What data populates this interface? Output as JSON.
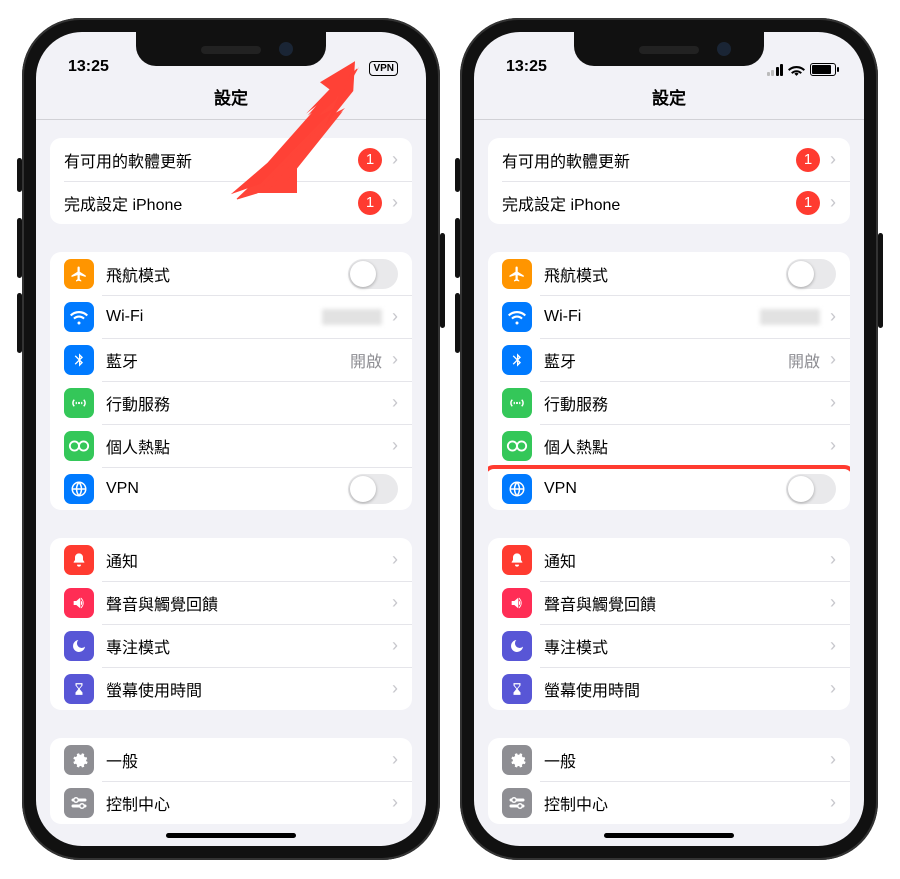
{
  "status": {
    "time": "13:25",
    "vpn_label": "VPN"
  },
  "nav": {
    "title": "設定"
  },
  "group_updates": {
    "software_update": "有可用的軟體更新",
    "software_badge": "1",
    "finish_setup": "完成設定 iPhone",
    "finish_badge": "1"
  },
  "group_net": {
    "airplane": "飛航模式",
    "wifi": "Wi-Fi",
    "bluetooth": "藍牙",
    "bluetooth_status": "開啟",
    "cellular": "行動服務",
    "hotspot": "個人熱點",
    "vpn": "VPN"
  },
  "group_notify": {
    "notifications": "通知",
    "sounds": "聲音與觸覺回饋",
    "focus": "專注模式",
    "screentime": "螢幕使用時間"
  },
  "group_general": {
    "general": "一般",
    "control": "控制中心"
  },
  "colors": {
    "orange": "#ff9500",
    "blue": "#007aff",
    "green": "#34c759",
    "red": "#ff3b30",
    "purple": "#5856d6",
    "gray": "#8e8e93",
    "indigo": "#5856d6",
    "darkblue": "#0a84ff"
  }
}
